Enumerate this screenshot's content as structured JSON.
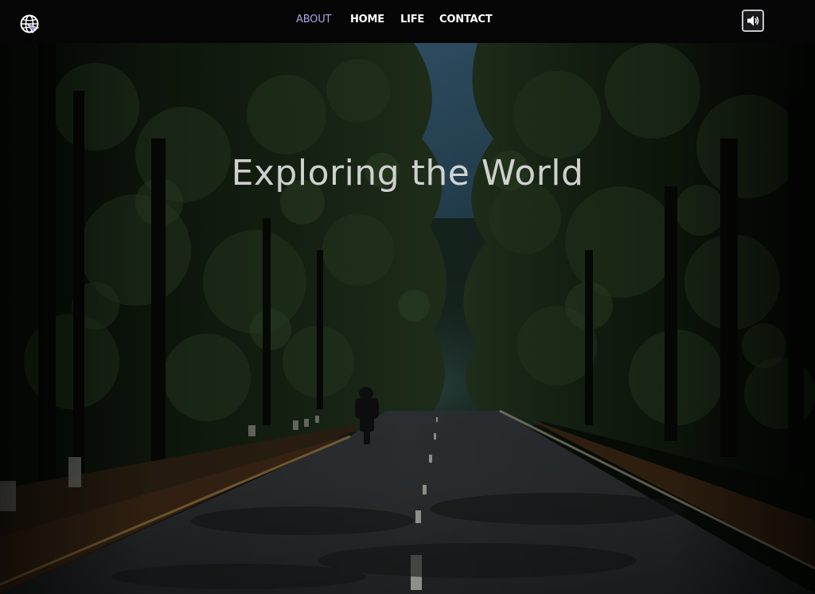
{
  "nav": {
    "logo_icon": "globe-icon",
    "links": [
      {
        "label": "ABOUT",
        "active": true
      },
      {
        "label": "HOME",
        "active": false
      },
      {
        "label": "LIFE",
        "active": false
      },
      {
        "label": "CONTACT",
        "active": false
      }
    ],
    "sound_icon": "speaker-volume-icon"
  },
  "hero": {
    "title": "Exploring the World"
  },
  "colors": {
    "nav_background": "#050506",
    "nav_text": "#ffffff",
    "nav_active": "#a7a7e3",
    "title_text": "#e8e8e8"
  }
}
